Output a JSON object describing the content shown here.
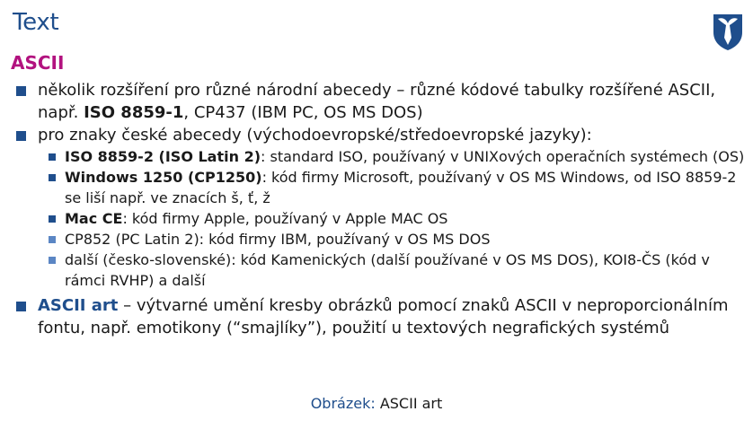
{
  "frame": {
    "title": "Text"
  },
  "block": {
    "title": "ASCII"
  },
  "items": {
    "i1": {
      "a": "několik rozšíření pro různé národní abecedy – různé kódové tabulky rozšířené ASCII, např. ",
      "b": "ISO 8859-1",
      "c": ", CP437 (IBM PC, OS MS DOS)"
    },
    "i2": {
      "text": "pro znaky české abecedy (východoevropské/středoevropské jazyky):"
    },
    "s1": {
      "bold": "ISO 8859-2 (ISO Latin 2)",
      "rest": ": standard ISO, používaný v UNIXových operačních systémech (OS)"
    },
    "s2": {
      "bold": "Windows 1250 (CP1250)",
      "rest": ": kód firmy Microsoft, používaný v OS MS Windows, od ISO 8859-2 se liší např. ve znacích š, ť, ž"
    },
    "s3": {
      "bold": "Mac CE",
      "rest": ": kód firmy Apple, používaný v Apple MAC OS"
    },
    "s4": {
      "text": "CP852 (PC Latin 2): kód firmy IBM, používaný v OS MS DOS"
    },
    "s5": {
      "text": "další (česko-slovenské): kód Kamenických (další používané v OS MS DOS), KOI8-ČS (kód v rámci RVHP) a další"
    },
    "art": {
      "title": "ASCII art",
      "rest": " – výtvarné umění kresby obrázků pomocí znaků ASCII v neproporcionálním fontu, např. emotikony (“smajlíky”), použití u textových negrafických systémů"
    }
  },
  "caption": {
    "label": "Obrázek:",
    "text": " ASCII art"
  },
  "colors": {
    "title": "#1f4e8c",
    "block": "#b2127f",
    "bullet": "#1f4e8c"
  },
  "icons": {
    "logo": "university-shield-logo-icon"
  }
}
